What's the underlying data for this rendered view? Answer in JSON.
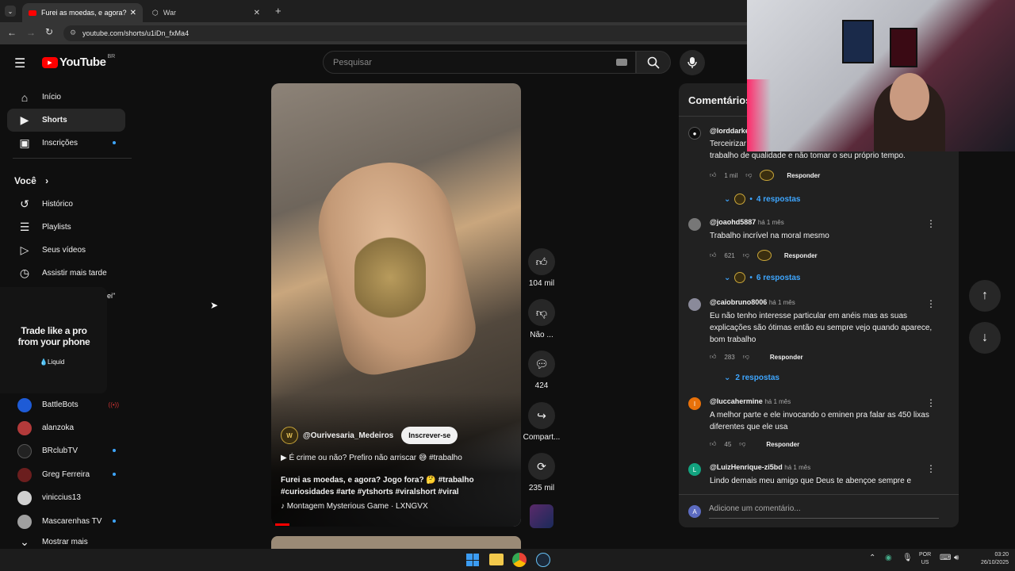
{
  "browser": {
    "tabs": [
      {
        "title": "Furei as moedas, e agora? J"
      },
      {
        "title": "War"
      }
    ],
    "url": "youtube.com/shorts/u1iDn_fxMa4"
  },
  "youtube": {
    "logo": "YouTube",
    "region": "BR",
    "search_placeholder": "Pesquisar",
    "sidebar": {
      "main": [
        {
          "label": "Início",
          "icon": "home-icon"
        },
        {
          "label": "Shorts",
          "icon": "shorts-icon"
        },
        {
          "label": "Inscrições",
          "icon": "subscriptions-icon"
        }
      ],
      "you_header": "Você",
      "you_items": [
        {
          "label": "Histórico",
          "icon": "history-icon"
        },
        {
          "label": "Playlists",
          "icon": "playlists-icon"
        },
        {
          "label": "Seus vídeos",
          "icon": "videos-icon"
        },
        {
          "label": "Assistir mais tarde",
          "icon": "watch-later-icon"
        }
      ],
      "partial_text": "ei\"",
      "ad": {
        "title": "Trade like a pro from your phone",
        "brand": "Liquid"
      },
      "channels": [
        {
          "name": "BattleBots",
          "color": "#1e5bd6"
        },
        {
          "name": "alanzoka",
          "color": "#b23a3a"
        },
        {
          "name": "BRclubTV",
          "color": "#222"
        },
        {
          "name": "Greg Ferreira",
          "color": "#6b1e1e"
        },
        {
          "name": "viniccius13",
          "color": "#d0d0d0"
        },
        {
          "name": "Mascarenhas TV",
          "color": "#a0a0a0"
        }
      ],
      "show_more": "Mostrar mais"
    },
    "short": {
      "channel": "@Ourivesaria_Medeiros",
      "subscribe": "Inscrever-se",
      "pinned_line": "É crime ou não? Prefiro não arriscar 😅 #trabalho",
      "title": "Furei as moedas, e agora? Jogo fora? 🤔 #trabalho",
      "tags": "#curiosidades #arte #ytshorts #viralshort #viral",
      "music": "Montagem Mysterious Game · LXNGVX",
      "actions": {
        "likes": "104 mil",
        "dislike": "Não ...",
        "comments": "424",
        "share": "Compart...",
        "remix": "235 mil"
      }
    },
    "comments_panel": {
      "title": "Comentários",
      "add_placeholder": "Adicione um comentário...",
      "items": [
        {
          "author": "@lorddarke",
          "time": "",
          "text_partial": "Terceirizar tra",
          "text2": "trabalho de qualidade e não tomar o seu próprio tempo.",
          "likes": "1 mil",
          "reply": "Responder",
          "replies": "4 respostas"
        },
        {
          "author": "@joaohd5887",
          "time": "há 1 mês",
          "text": "Trabalho incrível na moral mesmo",
          "likes": "621",
          "reply": "Responder",
          "replies": "6 respostas"
        },
        {
          "author": "@caiobruno8006",
          "time": "há 1 mês",
          "text": "Eu não tenho interesse particular em anéis mas as suas explicações são ótimas então eu sempre vejo quando aparece, bom trabalho",
          "likes": "283",
          "reply": "Responder",
          "replies": "2 respostas"
        },
        {
          "author": "@luccahermine",
          "time": "há 1 mês",
          "text": "A melhor parte e ele invocando o eminen pra falar as 450 lixas diferentes que ele usa",
          "likes": "45",
          "reply": "Responder",
          "avatar_letter": "l",
          "avatar_color": "#e8710a"
        },
        {
          "author": "@LuizHenrique-zi5bd",
          "time": "há 1 mês",
          "text": "Lindo demais meu amigo que Deus te abençoe sempre e",
          "avatar_letter": "L",
          "avatar_color": "#12a37f"
        }
      ],
      "input_avatar": "A"
    }
  },
  "taskbar": {
    "lang": "POR",
    "lang2": "US",
    "time": "03:20",
    "date": "26/10/2025"
  }
}
